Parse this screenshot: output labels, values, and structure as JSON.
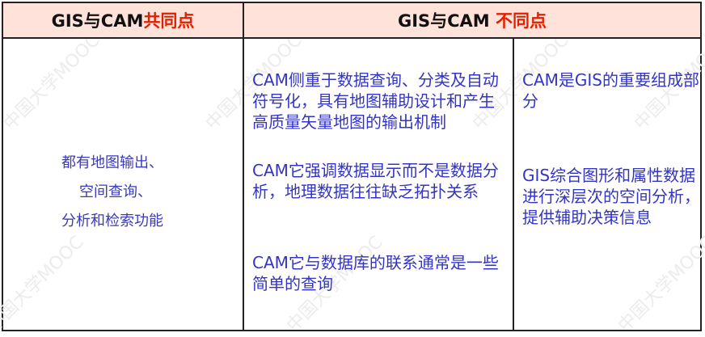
{
  "header": {
    "left_prefix": "GIS与CAM",
    "left_highlight": "共同点",
    "right_prefix": "GIS与CAM ",
    "right_highlight": "不同点"
  },
  "common": [
    "都有地图输出、",
    "空间查询、",
    "分析和检索功能"
  ],
  "differences_cam": [
    "CAM侧重于数据查询、分类及自动符号化，具有地图辅助设计和产生高质量矢量地图的输出机制",
    "CAM它强调数据显示而不是数据分析，地理数据往往缺乏拓扑关系",
    "CAM它与数据库的联系通常是一些简单的查询"
  ],
  "differences_gis": [
    "CAM是GIS的重要组成部分",
    "GIS综合图形和属性数据进行深层次的空间分析，提供辅助决策信息"
  ],
  "watermark": "中国大学MOOC",
  "colors": {
    "header_bg": "#ffe2d9",
    "highlight": "#e02000",
    "body_text": "#3434c4"
  }
}
